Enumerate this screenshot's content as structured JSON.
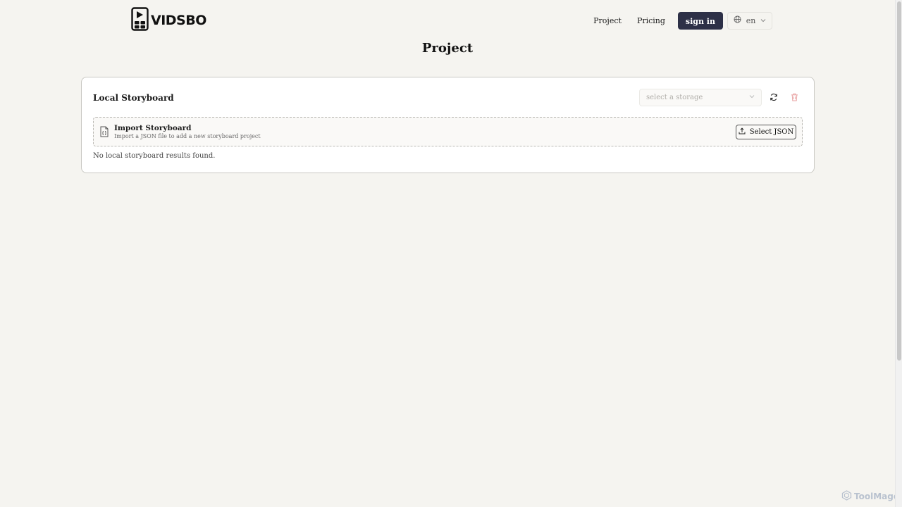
{
  "header": {
    "logo_text": "VIDSBO",
    "nav": {
      "project": "Project",
      "pricing": "Pricing",
      "signin": "sign in",
      "language": "en"
    }
  },
  "page_title": "Project",
  "card": {
    "title": "Local Storyboard",
    "storage_placeholder": "select a storage",
    "import": {
      "title": "Import Storyboard",
      "description": "Import a JSON file to add a new storyboard project",
      "button": "Select JSON"
    },
    "empty_message": "No local storyboard results found."
  },
  "watermark": "ToolMage",
  "colors": {
    "background": "#f5f4f0",
    "signin_bg": "#2d3047",
    "trash_icon": "#e8a1a1"
  },
  "icons": {
    "logo": "film-phone-icon",
    "language": "globe-icon",
    "dropdown": "chevron-down-icon",
    "refresh": "refresh-icon",
    "delete": "trash-icon",
    "file": "file-icon",
    "upload": "upload-icon"
  }
}
